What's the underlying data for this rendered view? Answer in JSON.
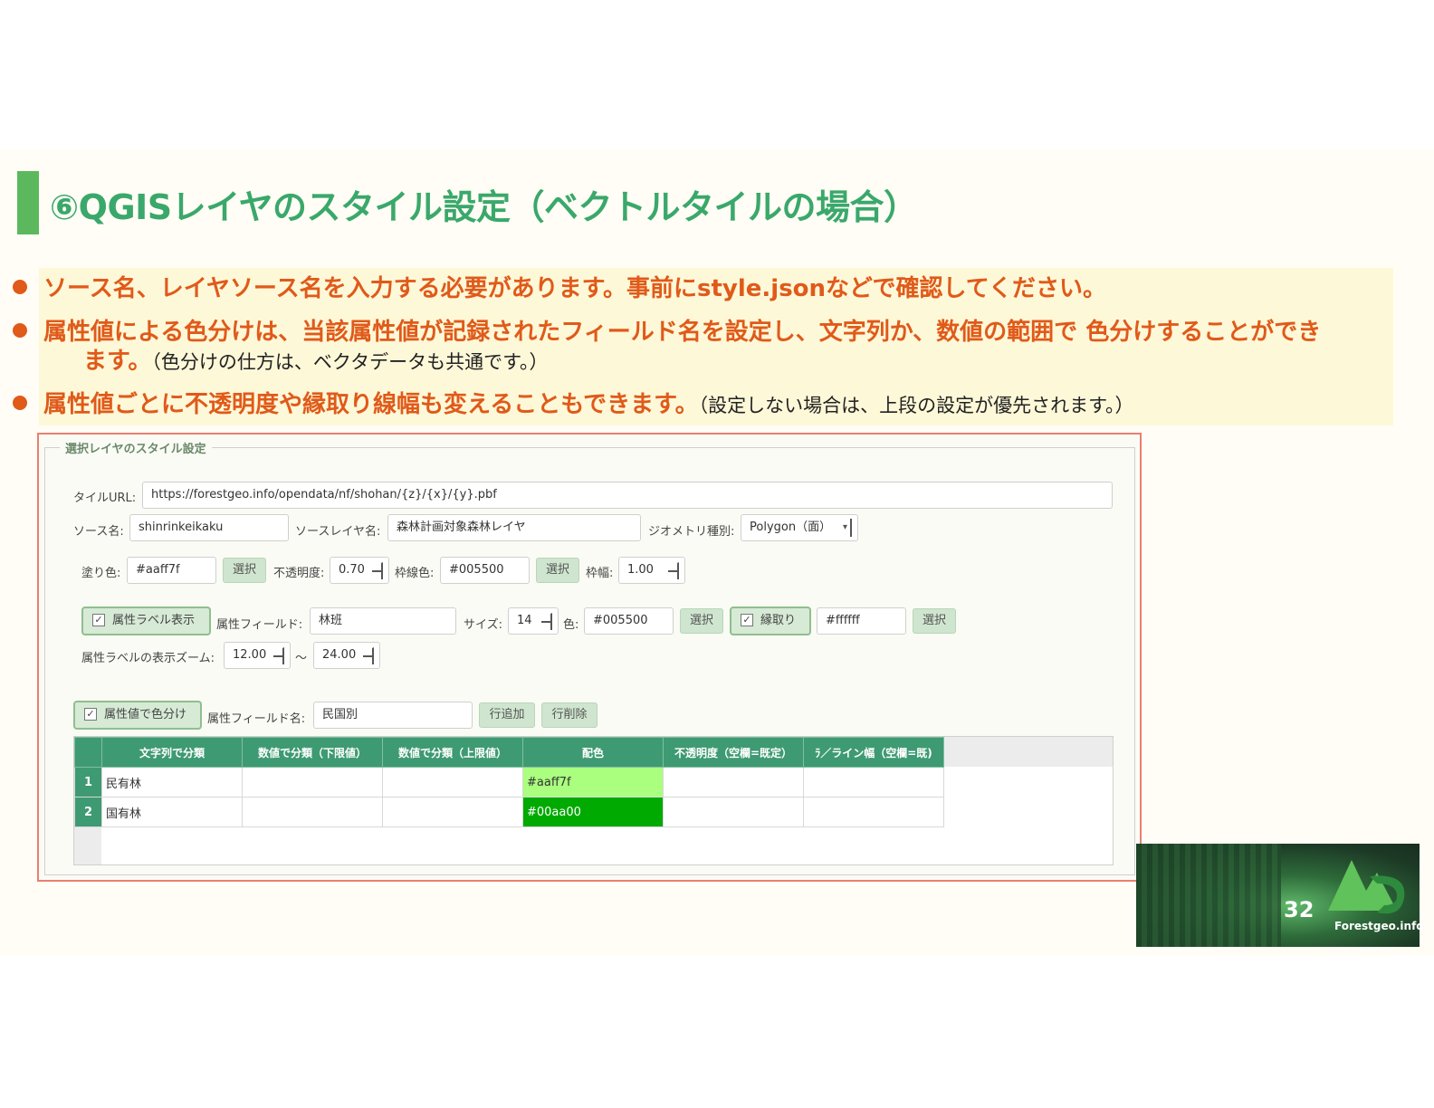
{
  "slide": {
    "title": "⑥QGISレイヤのスタイル設定（ベクトルタイルの場合）",
    "bullets": [
      {
        "text": "ソース名、レイヤソース名を入力する必要があります。事前にstyle.jsonなどで確認してください。",
        "note": ""
      },
      {
        "text": "属性値による色分けは、当該属性値が記録されたフィールド名を設定し、文字列か、数値の範囲で 色分けすることができ",
        "text2": "ます。",
        "note": "（色分けの仕方は、ベクタデータも共通です。）"
      },
      {
        "text": "属性値ごとに不透明度や縁取り線幅も変えることもできます。",
        "note": "（設定しない場合は、上段の設定が優先されます。）"
      }
    ],
    "page_number": "32",
    "logo_text": "Forestgeo.info"
  },
  "dialog": {
    "group_title": "選択レイヤのスタイル設定",
    "tile_url_label": "タイルURL:",
    "tile_url": "https://forestgeo.info/opendata/nf/shohan/{z}/{x}/{y}.pbf",
    "source_name_label": "ソース名:",
    "source_name": "shinrinkeikaku",
    "source_layer_label": "ソースレイヤ名:",
    "source_layer": "森林計画対象森林レイヤ",
    "geometry_label": "ジオメトリ種別:",
    "geometry": "Polygon（面）",
    "fill_color_label": "塗り色:",
    "fill_color": "#aaff7f",
    "select_label": "選択",
    "opacity_label": "不透明度:",
    "opacity": "0.70",
    "stroke_color_label": "枠線色:",
    "stroke_color": "#005500",
    "stroke_width_label": "枠幅:",
    "stroke_width": "1.00",
    "show_label_check": "属性ラベル表示",
    "label_field_label": "属性フィールド:",
    "label_field": "林班",
    "size_label": "サイズ:",
    "size": "14",
    "label_color_label": "色:",
    "label_color": "#005500",
    "halo_check": "縁取り",
    "halo_color": "#ffffff",
    "zoom_label": "属性ラベルの表示ズーム:",
    "zoom_min": "12.00",
    "zoom_sep": "～",
    "zoom_max": "24.00",
    "classify_check": "属性値で色分け",
    "classify_field_label": "属性フィールド名:",
    "classify_field": "民国別",
    "add_row": "行追加",
    "delete_row": "行削除",
    "table": {
      "headers": [
        "文字列で分類",
        "数値で分類（下限値）",
        "数値で分類（上限値）",
        "配色",
        "不透明度（空欄=既定）",
        "ﾗ／ライン幅（空欄=既)"
      ],
      "rows": [
        {
          "num": "1",
          "cells": [
            "民有林",
            "",
            "",
            "#aaff7f",
            "",
            ""
          ],
          "color": "#aaff7f"
        },
        {
          "num": "2",
          "cells": [
            "国有林",
            "",
            "",
            "#00aa00",
            "",
            ""
          ],
          "color": "#00aa00"
        }
      ]
    }
  }
}
